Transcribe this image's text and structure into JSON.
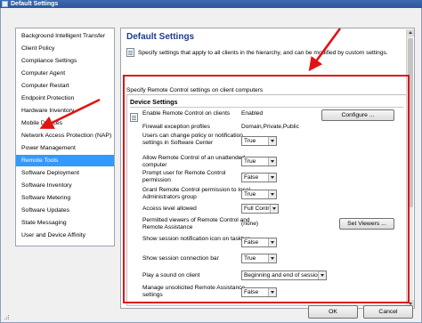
{
  "window": {
    "title": "Default Settings"
  },
  "sidebar": {
    "items": [
      {
        "label": "Background Intelligent Transfer"
      },
      {
        "label": "Client Policy"
      },
      {
        "label": "Compliance Settings"
      },
      {
        "label": "Computer Agent"
      },
      {
        "label": "Computer Restart"
      },
      {
        "label": "Endpoint Protection"
      },
      {
        "label": "Hardware Inventory"
      },
      {
        "label": "Mobile Devices"
      },
      {
        "label": "Network Access Protection (NAP)"
      },
      {
        "label": "Power Management"
      },
      {
        "label": "Remote Tools",
        "selected": true
      },
      {
        "label": "Software Deployment"
      },
      {
        "label": "Software Inventory"
      },
      {
        "label": "Software Metering"
      },
      {
        "label": "Software Updates"
      },
      {
        "label": "State Messaging"
      },
      {
        "label": "User and Device Affinity"
      }
    ]
  },
  "main": {
    "title": "Default Settings",
    "intro": "Specify settings that apply to all clients in the hierarchy, and can be modified by custom settings.",
    "group_label": "Specify Remote Control settings on client computers",
    "section_title": "Device Settings",
    "rows": [
      {
        "label": "Enable Remote Control on clients",
        "value": "Enabled",
        "button": "Configure ..."
      },
      {
        "label": "Firewall exception profiles",
        "value": "Domain,Private,Public"
      },
      {
        "label": "Users can change policy or notification settings in Software Center",
        "select": "True"
      },
      {
        "label": "Allow Remote Control of an unattended computer",
        "select": "True"
      },
      {
        "label": "Prompt user for Remote Control permission",
        "select": "False"
      },
      {
        "label": "Grant Remote Control permission to local Administrators group",
        "select": "True"
      },
      {
        "label": "Access level allowed",
        "select": "Full Control"
      },
      {
        "label": "Permitted viewers of Remote Control and Remote Assistance",
        "value": "(none)",
        "button": "Set Viewers ..."
      },
      {
        "label": "Show session notification icon on taskbar",
        "select": "False"
      },
      {
        "label": "Show session connection bar",
        "select": "True"
      },
      {
        "label": "Play a sound on client",
        "select": "Beginning and end of session"
      },
      {
        "label": "Manage unsolicited Remote Assistance settings",
        "select": "False"
      }
    ]
  },
  "footer": {
    "ok_label": "OK",
    "cancel_label": "Cancel"
  },
  "colors": {
    "annotation": "#e01414",
    "selection": "#3399ff",
    "title_blue": "#1e3d8f"
  }
}
